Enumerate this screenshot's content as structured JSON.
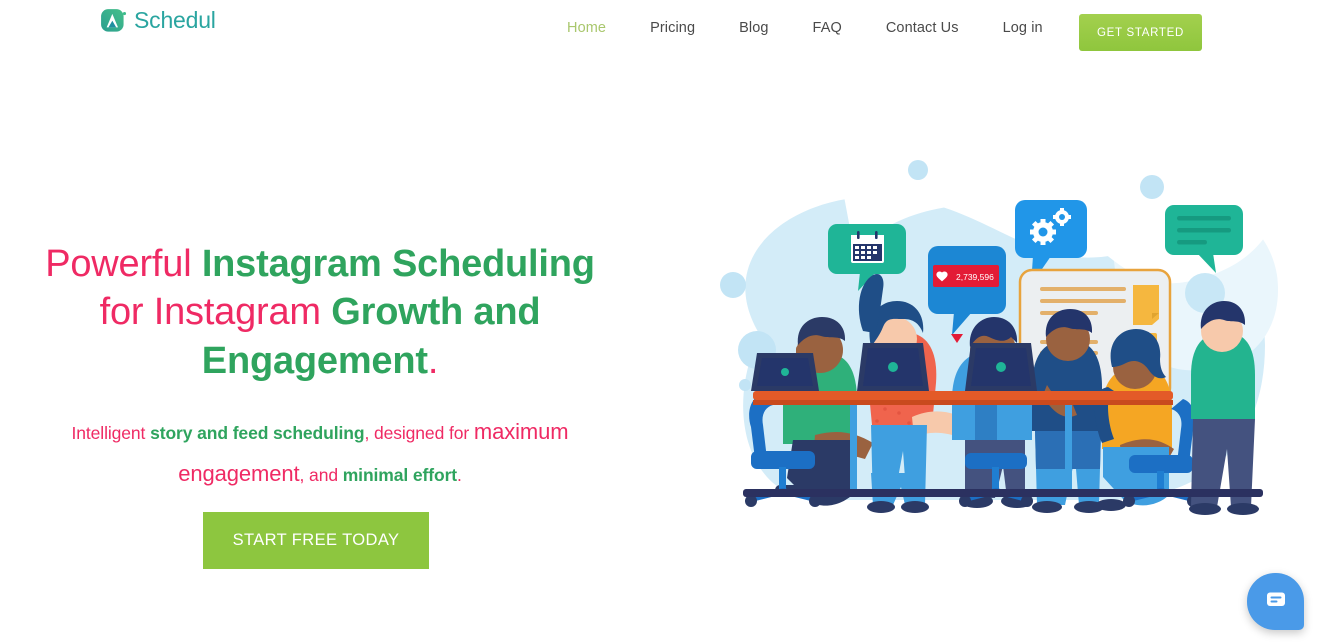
{
  "brand": {
    "name": "Schedul",
    "logo_icon": "triangle-a-logo-icon",
    "color": "#2aa5a0"
  },
  "header": {
    "nav": [
      {
        "label": "Home",
        "active": true
      },
      {
        "label": "Pricing",
        "active": false
      },
      {
        "label": "Blog",
        "active": false
      },
      {
        "label": "FAQ",
        "active": false
      },
      {
        "label": "Contact Us",
        "active": false
      },
      {
        "label": "Log in",
        "active": false
      }
    ],
    "cta_label": "GET STARTED",
    "cta_color": "#8fc63d",
    "active_nav_color": "#a9c76d",
    "nav_color": "#4a4a4a"
  },
  "hero": {
    "headline": {
      "part1": "Powerful ",
      "part2": "Instagram Scheduling",
      "part3": " for Instagram ",
      "part4": "Growth and Engagement",
      "part5": "."
    },
    "subhead": {
      "part1": "Intelligent ",
      "part2": "story and feed scheduling",
      "part3": ", designed for ",
      "part4": "maximum engagement",
      "part5": ", and ",
      "part6": "minimal effort",
      "part7": "."
    },
    "cta_label": "START FREE TODAY",
    "cta_color": "#8dc63f",
    "pink": "#ef2a64",
    "green": "#2fa45e"
  },
  "illustration": {
    "name": "team-collaboration-illustration",
    "blob_color": "#d3ecf8",
    "bubbles": [
      {
        "name": "calendar-bubble",
        "color": "#1fb597",
        "icon": "calendar-icon"
      },
      {
        "name": "likes-bubble",
        "color": "#1c87d4",
        "icon": "heart-icon",
        "badge_count": "2,739,596",
        "badge_color": "#e31b36"
      },
      {
        "name": "gears-bubble",
        "color": "#2196e8",
        "icon": "gears-icon"
      },
      {
        "name": "message-bubble",
        "color": "#1fb597",
        "icon": "text-lines-icon"
      }
    ]
  },
  "chat_widget": {
    "icon": "chat-bubble-icon",
    "color": "#4a9ae8"
  }
}
